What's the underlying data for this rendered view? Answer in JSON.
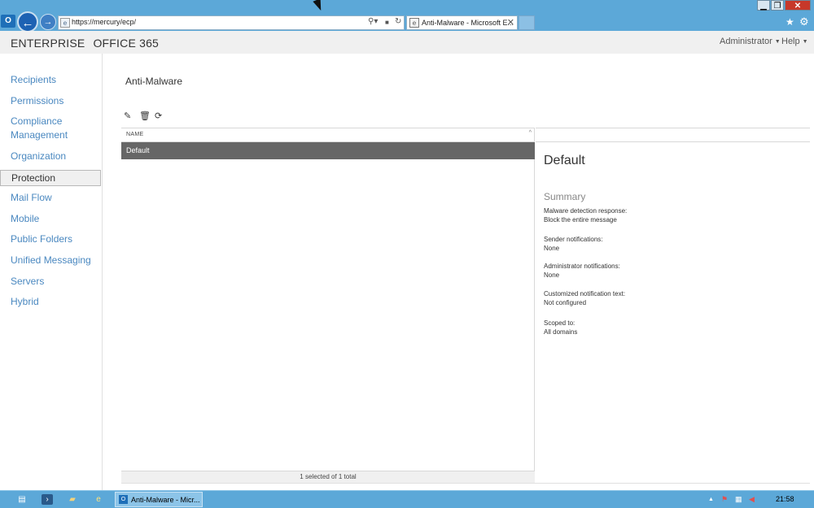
{
  "browser": {
    "url": "https://mercury/ecp/",
    "tab_title": "Anti-Malware - Microsoft E...",
    "window_buttons": {
      "minimize": "▁",
      "maximize": "❐",
      "close": "✕"
    },
    "address_tools": {
      "search": "⚲▾",
      "lock": "🔒",
      "refresh": "↻"
    }
  },
  "header": {
    "brand_enterprise": "ENTERPRISE",
    "brand_office": "OFFICE 365",
    "user": "Administrator",
    "help": "Help"
  },
  "nav": {
    "items": [
      {
        "label": "Recipients"
      },
      {
        "label": "Permissions"
      },
      {
        "label": "Compliance"
      },
      {
        "label": "Management"
      },
      {
        "label": "Organization"
      },
      {
        "label": "Protection",
        "active": true
      },
      {
        "label": "Mail Flow"
      },
      {
        "label": "Mobile"
      },
      {
        "label": "Public Folders"
      },
      {
        "label": "Unified Messaging"
      },
      {
        "label": "Servers"
      },
      {
        "label": "Hybrid"
      }
    ]
  },
  "page": {
    "title": "Anti-Malware"
  },
  "list": {
    "column_name": "NAME",
    "rows": [
      {
        "name": "Default",
        "selected": true
      }
    ],
    "status": "1 selected of 1 total"
  },
  "detail": {
    "title": "Default",
    "summary_label": "Summary",
    "fields": [
      {
        "label": "Malware detection response:",
        "value": "Block the entire message"
      },
      {
        "label": "Sender notifications:",
        "value": "None"
      },
      {
        "label": "Administrator notifications:",
        "value": "None"
      },
      {
        "label": "Customized notification text:",
        "value": "Not configured"
      },
      {
        "label": "Scoped to:",
        "value": "All domains"
      }
    ]
  },
  "taskbar": {
    "task_label": "Anti-Malware - Micr...",
    "clock": "21:58"
  },
  "colors": {
    "chrome_blue": "#5ca8d8",
    "nav_link": "#4a88c0",
    "selected_row": "#666666"
  }
}
